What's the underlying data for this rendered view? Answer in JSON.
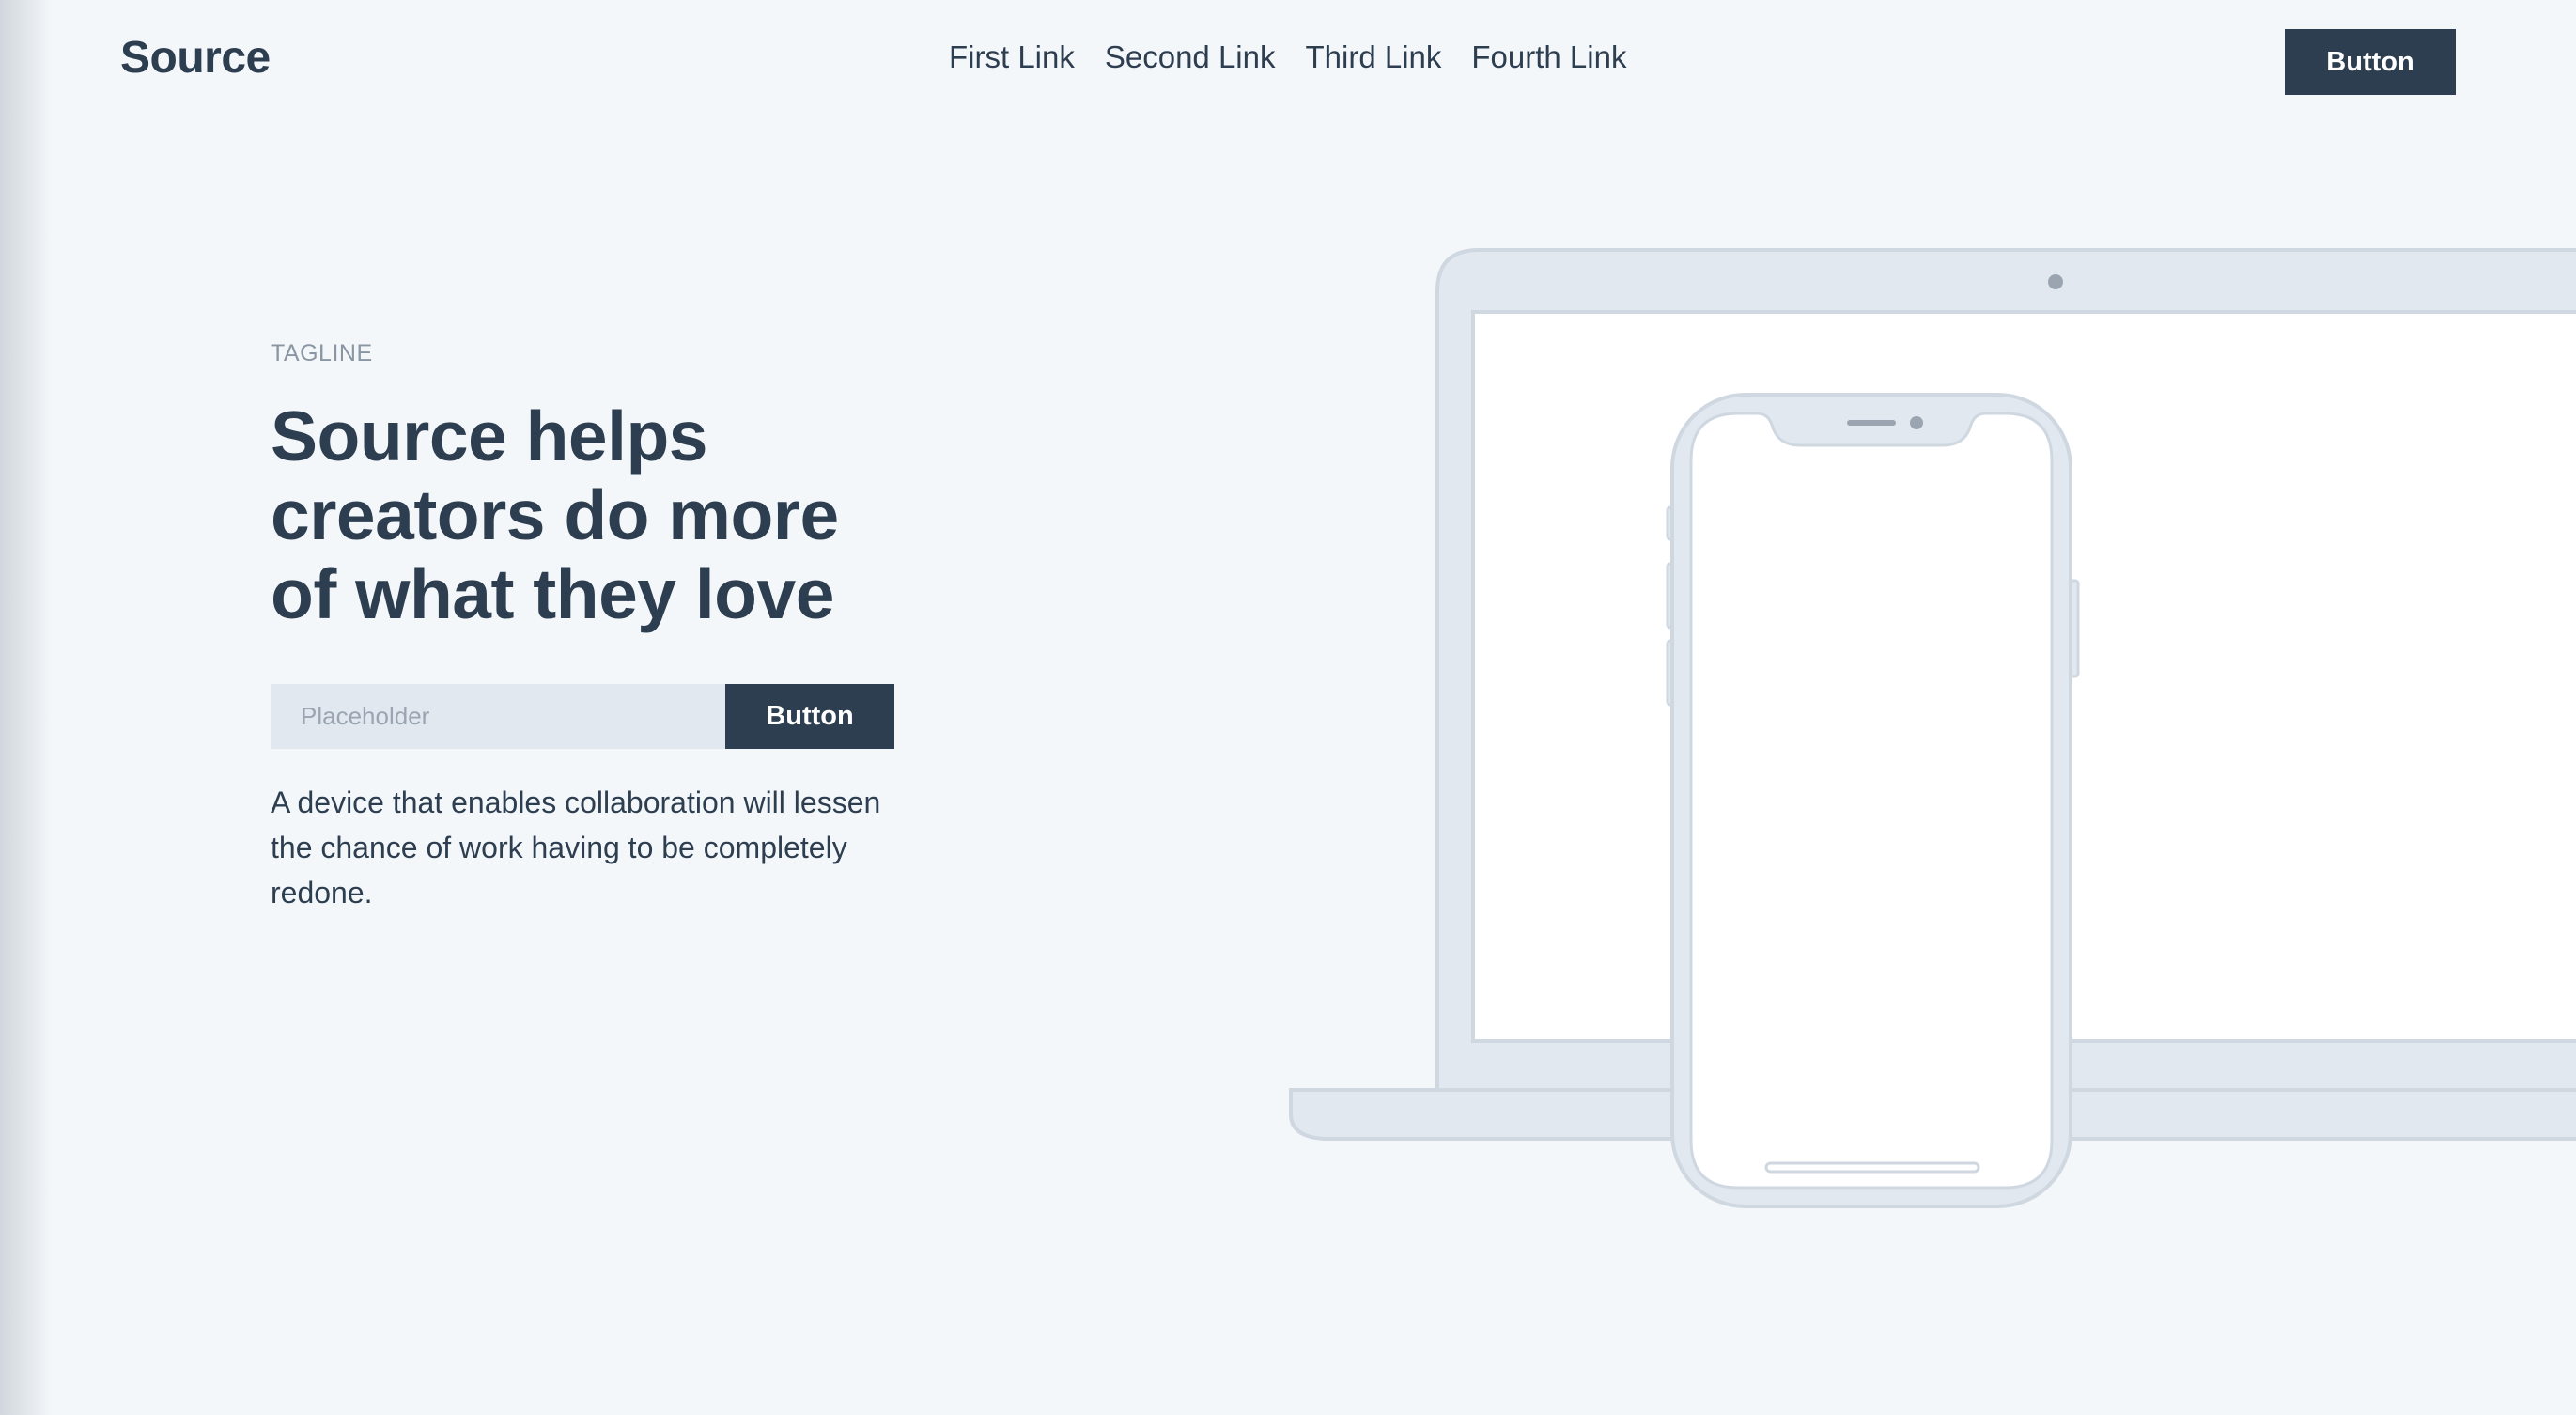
{
  "header": {
    "logo": "Source",
    "nav": [
      "First Link",
      "Second Link",
      "Third Link",
      "Fourth Link"
    ],
    "button_label": "Button"
  },
  "hero": {
    "tagline": "TAGLINE",
    "headline": "Source helps creators do more of what they love",
    "input_placeholder": "Placeholder",
    "button_label": "Button",
    "description": "A device that enables collaboration will lessen the chance of work having to be completely redone."
  },
  "illustration": {
    "devices": [
      "laptop",
      "phone"
    ],
    "frame_color": "#e2e8ef",
    "stroke_color": "#cfd7e0",
    "screen_color": "#ffffff"
  },
  "colors": {
    "background": "#f4f7fa",
    "primary": "#2d3e50",
    "muted": "#8a96a3"
  }
}
